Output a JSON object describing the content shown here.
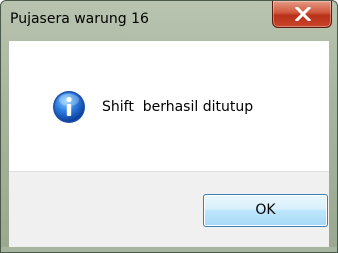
{
  "window": {
    "title": "Pujasera warung 16"
  },
  "dialog": {
    "message": "Shift  berhasil ditutup",
    "icon": "information-icon",
    "ok_label": "OK"
  },
  "colors": {
    "frame": "#a7b59e",
    "close_button": "#c9442a",
    "ok_border": "#3c7fb1",
    "footer": "#f0f0f0"
  }
}
